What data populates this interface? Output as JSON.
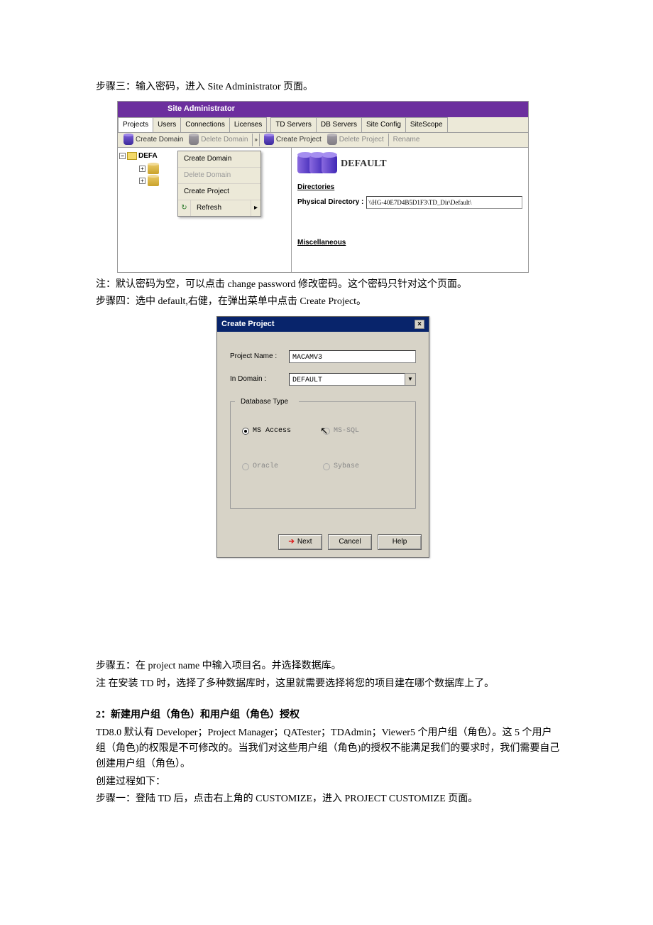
{
  "doc": {
    "step3": "步骤三：输入密码，进入 Site Administrator 页面。",
    "note1": "注：默认密码为空，可以点击 change password 修改密码。这个密码只针对这个页面。",
    "step4": "步骤四：选中 default,右健，在弹出菜单中点击 Create Project。",
    "step5": "步骤五：在 project name 中输入项目名。并选择数据库。",
    "note2": "注 在安装 TD 时，选择了多种数据库时，这里就需要选择将您的项目建在哪个数据库上了。",
    "section2_title": "2：新建用户组（角色）和用户组（角色）授权",
    "section2_p1": "TD8.0 默认有 Developer；Project Manager；QATester；TDAdmin；Viewer5 个用户组（角色）。这 5 个用户组（角色)的权限是不可修改的。当我们对这些用户组（角色)的授权不能满足我们的要求时，我们需要自己创建用户组（角色）。",
    "section2_p2": "创建过程如下：",
    "section2_p3": "步骤一：登陆 TD 后，点击右上角的 CUSTOMIZE，进入 PROJECT CUSTOMIZE 页面。"
  },
  "sa": {
    "title": "Site Administrator",
    "tabs": [
      "Projects",
      "Users",
      "Connections",
      "Licenses",
      "TD Servers",
      "DB Servers",
      "Site Config",
      "SiteScope"
    ],
    "toolbar": {
      "create_domain": "Create Domain",
      "delete_domain": "Delete Domain",
      "create_project": "Create Project",
      "delete_project": "Delete Project",
      "rename": "Rename"
    },
    "tree": {
      "root": "DEFA"
    },
    "context_menu": {
      "create_domain": "Create Domain",
      "delete_domain": "Delete Domain",
      "create_project": "Create Project",
      "refresh": "Refresh"
    },
    "right": {
      "heading": "DEFAULT",
      "directories": "Directories",
      "phys_label": "Physical Directory :",
      "phys_value": "\\\\HG-40E7D4B5D1F3\\TD_Dir\\Default\\",
      "misc": "Miscellaneous"
    }
  },
  "cp": {
    "title": "Create Project",
    "labels": {
      "project_name": "Project Name :",
      "in_domain": "In Domain :",
      "db_type": "Database Type"
    },
    "values": {
      "project_name": "MACAMV3",
      "in_domain": "DEFAULT"
    },
    "radios": {
      "ms_access": "MS Access",
      "ms_sql": "MS-SQL",
      "oracle": "Oracle",
      "sybase": "Sybase"
    },
    "buttons": {
      "next": "Next",
      "cancel": "Cancel",
      "help": "Help"
    }
  }
}
